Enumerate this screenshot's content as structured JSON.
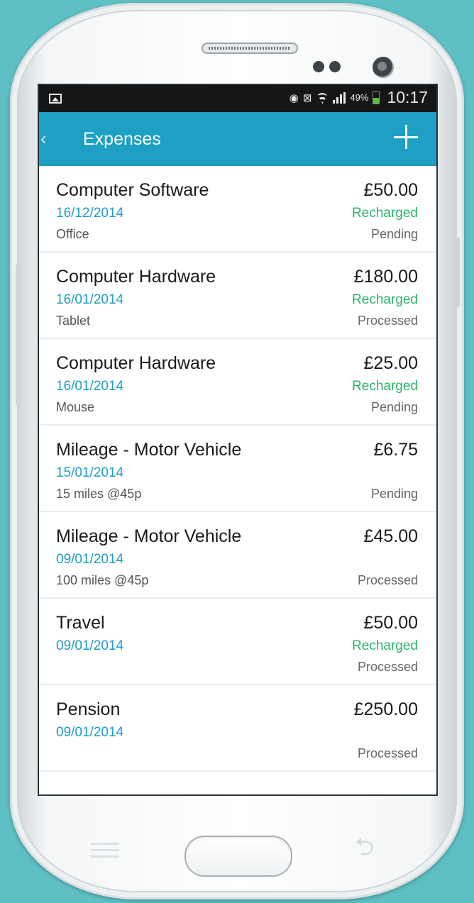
{
  "status_bar": {
    "battery_percent": "49%",
    "time": "10:17",
    "icons": [
      "image-icon",
      "eye-icon",
      "no-signal-icon",
      "wifi-icon",
      "signal-bars-icon",
      "battery-icon"
    ]
  },
  "app_bar": {
    "back_glyph": "‹",
    "title": "Expenses",
    "add_icon": "plus-icon",
    "color": "#1ea0c4"
  },
  "expenses": [
    {
      "title": "Computer Software",
      "date": "16/12/2014",
      "description": "Office",
      "amount": "£50.00",
      "recharge": "Recharged",
      "status": "Pending"
    },
    {
      "title": "Computer Hardware",
      "date": "16/01/2014",
      "description": "Tablet",
      "amount": "£180.00",
      "recharge": "Recharged",
      "status": "Processed"
    },
    {
      "title": "Computer Hardware",
      "date": "16/01/2014",
      "description": "Mouse",
      "amount": "£25.00",
      "recharge": "Recharged",
      "status": "Pending"
    },
    {
      "title": "Mileage - Motor Vehicle",
      "date": "15/01/2014",
      "description": "15 miles @45p",
      "amount": "£6.75",
      "recharge": "",
      "status": "Pending"
    },
    {
      "title": "Mileage - Motor Vehicle",
      "date": "09/01/2014",
      "description": "100 miles @45p",
      "amount": "£45.00",
      "recharge": "",
      "status": "Processed"
    },
    {
      "title": "Travel",
      "date": "09/01/2014",
      "description": "",
      "amount": "£50.00",
      "recharge": "Recharged",
      "status": "Processed"
    },
    {
      "title": "Pension",
      "date": "09/01/2014",
      "description": "",
      "amount": "£250.00",
      "recharge": "",
      "status": "Processed"
    }
  ],
  "colors": {
    "date": "#1e9cc4",
    "recharged": "#2bb36a",
    "background": "#5ec0c4"
  },
  "hardware_keys": {
    "back_glyph": "⮌"
  }
}
